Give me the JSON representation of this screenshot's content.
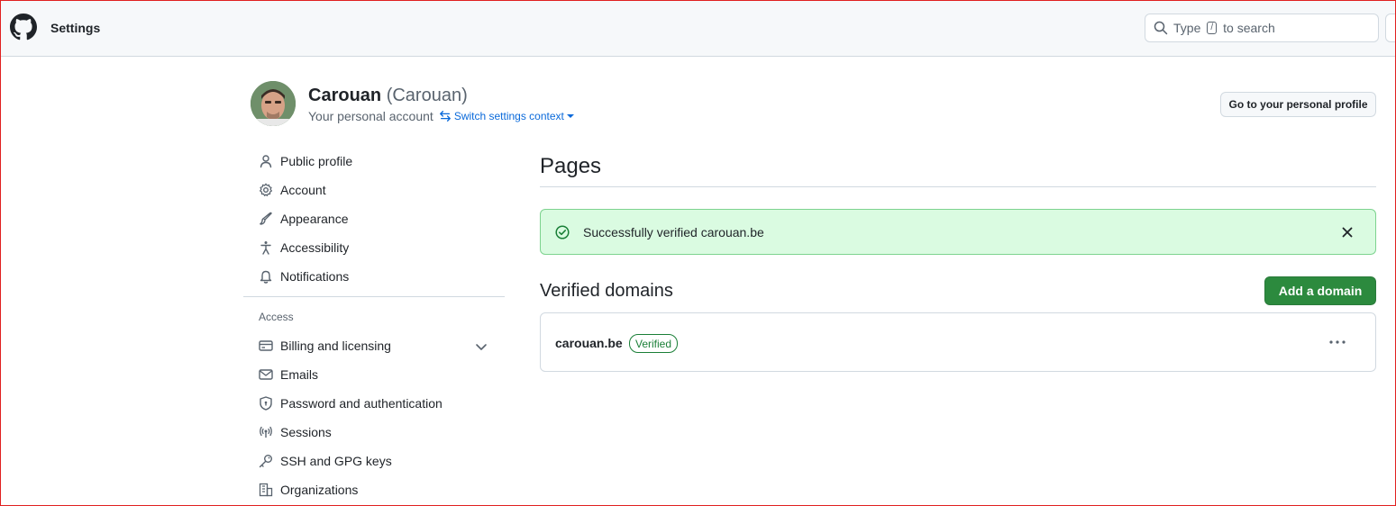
{
  "header": {
    "title": "Settings",
    "search": {
      "prefix": "Type",
      "key": "/",
      "suffix": "to search"
    }
  },
  "profile": {
    "name": "Carouan",
    "handle": "(Carouan)",
    "subtitle": "Your personal account",
    "switch_context": "Switch settings context",
    "go_to_profile": "Go to your personal profile"
  },
  "sidebar": {
    "items": [
      {
        "label": "Public profile",
        "icon": "person-icon"
      },
      {
        "label": "Account",
        "icon": "gear-icon"
      },
      {
        "label": "Appearance",
        "icon": "paintbrush-icon"
      },
      {
        "label": "Accessibility",
        "icon": "accessibility-icon"
      },
      {
        "label": "Notifications",
        "icon": "bell-icon"
      }
    ],
    "access_heading": "Access",
    "access_items": [
      {
        "label": "Billing and licensing",
        "icon": "credit-card-icon"
      },
      {
        "label": "Emails",
        "icon": "mail-icon"
      },
      {
        "label": "Password and authentication",
        "icon": "shield-lock-icon"
      },
      {
        "label": "Sessions",
        "icon": "broadcast-icon"
      },
      {
        "label": "SSH and GPG keys",
        "icon": "key-icon"
      },
      {
        "label": "Organizations",
        "icon": "organization-icon"
      }
    ]
  },
  "main": {
    "title": "Pages",
    "flash": "Successfully verified carouan.be",
    "section_title": "Verified domains",
    "add_domain": "Add a domain",
    "domains": [
      {
        "name": "carouan.be",
        "status": "Verified"
      }
    ]
  },
  "colors": {
    "accent_link": "#0969da",
    "success_bg": "#dafbe1",
    "success_border": "#7dd38f",
    "primary_button": "#2c8a3e",
    "badge_green": "#1a7f37"
  }
}
